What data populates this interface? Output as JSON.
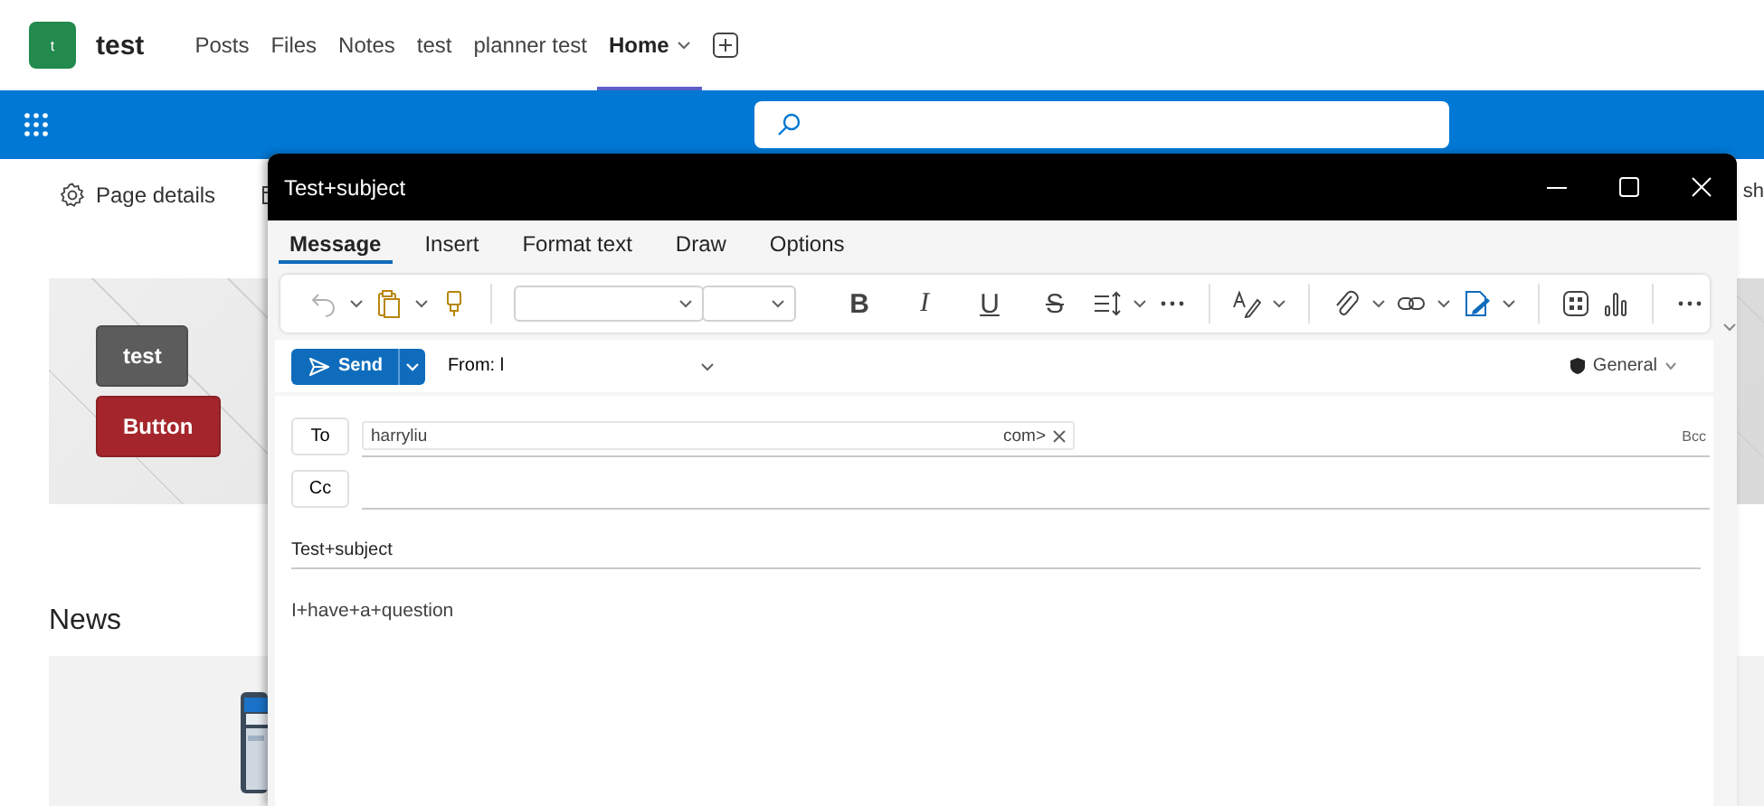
{
  "team": {
    "initial": "t",
    "name": "test"
  },
  "tabs": [
    {
      "label": "Posts",
      "selected": false,
      "kind": "plain"
    },
    {
      "label": "Files",
      "selected": false,
      "kind": "plain"
    },
    {
      "label": "Notes",
      "selected": false,
      "kind": "plain"
    },
    {
      "label": "test",
      "selected": false,
      "kind": "plain"
    },
    {
      "label": "planner test",
      "selected": false,
      "kind": "plain"
    },
    {
      "label": "Home",
      "selected": true,
      "kind": "dropdown"
    }
  ],
  "command_bar": {
    "page_details": "Page details",
    "right_cut": "sh"
  },
  "hero_buttons": [
    {
      "label": "test",
      "color": "#5c5c5c"
    },
    {
      "label": "Button",
      "color": "#a4262c"
    }
  ],
  "news": {
    "title": "News"
  },
  "compose": {
    "title": "Test+subject",
    "ribbon_tabs": [
      {
        "label": "Message",
        "selected": true
      },
      {
        "label": "Insert",
        "selected": false
      },
      {
        "label": "Format text",
        "selected": false
      },
      {
        "label": "Draw",
        "selected": false
      },
      {
        "label": "Options",
        "selected": false
      }
    ],
    "format_buttons": [
      {
        "label": "B",
        "kind": "bold"
      },
      {
        "label": "I",
        "kind": "italic"
      },
      {
        "label": "U",
        "kind": "underline"
      },
      {
        "label": "S",
        "kind": "strike"
      }
    ],
    "send": "Send",
    "from": "From: l",
    "sensitivity": "General",
    "to_label": "To",
    "recipients": [
      {
        "name": "harryliu",
        "address_end": "com>"
      }
    ],
    "bcc": "Bcc",
    "cc_label": "Cc",
    "subject": "Test+subject",
    "body": "I+have+a+question"
  }
}
